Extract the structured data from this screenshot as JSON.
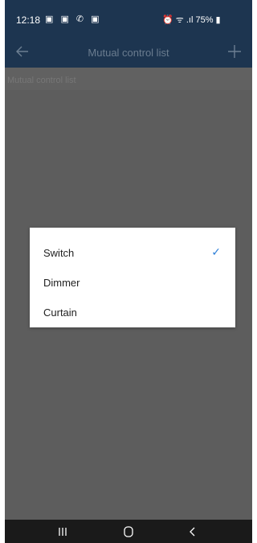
{
  "status_bar": {
    "time": "12:18",
    "left_icons": "▣ ▣ ✆ ▣",
    "right_icons": "⏰ ᯤ .ıl 75% ▮"
  },
  "app_bar": {
    "title": "Mutual control list",
    "back_icon": "arrow-left-icon",
    "add_icon": "plus-icon"
  },
  "content": {
    "section_header": "Mutual control list"
  },
  "dialog": {
    "options": [
      {
        "label": "Switch",
        "selected": true
      },
      {
        "label": "Dimmer",
        "selected": false
      },
      {
        "label": "Curtain",
        "selected": false
      }
    ],
    "check_mark": "✓",
    "check_color": "#2d7fd8"
  },
  "colors": {
    "app_bar": "#1d3550",
    "overlay": "#5d5d5d"
  }
}
